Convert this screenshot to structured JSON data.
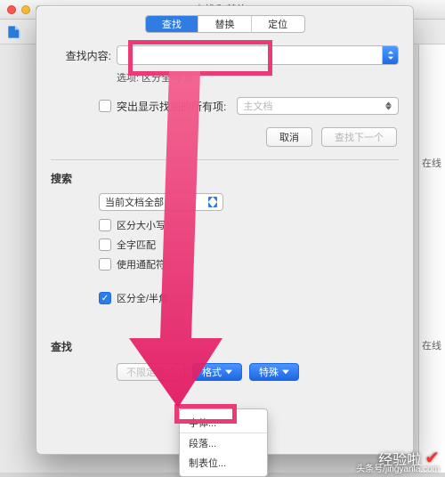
{
  "window": {
    "title": "查找和替换"
  },
  "tabs": {
    "find": "查找",
    "replace": "替换",
    "goto": "定位"
  },
  "find_row": {
    "label": "查找内容:"
  },
  "options_row": {
    "label": "选项:",
    "value": "区分全/半角"
  },
  "highlight": {
    "label": "突出显示找到的所有项:",
    "select_value": "主文档"
  },
  "buttons": {
    "cancel": "取消",
    "find_next": "查找下一个"
  },
  "search_section": {
    "title": "搜索",
    "scope": "当前文档全部",
    "case": "区分大小写",
    "whole": "全字匹配",
    "wildcard": "使用通配符",
    "fullhalf": "区分全/半角"
  },
  "find_section": {
    "title": "查找",
    "no_format": "不限定格式",
    "format": "格式",
    "special": "特殊"
  },
  "format_menu": {
    "font": "字体...",
    "paragraph": "段落...",
    "tabs": "制表位..."
  },
  "side": {
    "label1": "在线",
    "label2": "在线"
  },
  "watermark": {
    "main": "经验啦",
    "sub": "头条号/jingyanla.com"
  },
  "colors": {
    "accent": "#e83b77",
    "mac_blue": "#2f7de3"
  }
}
